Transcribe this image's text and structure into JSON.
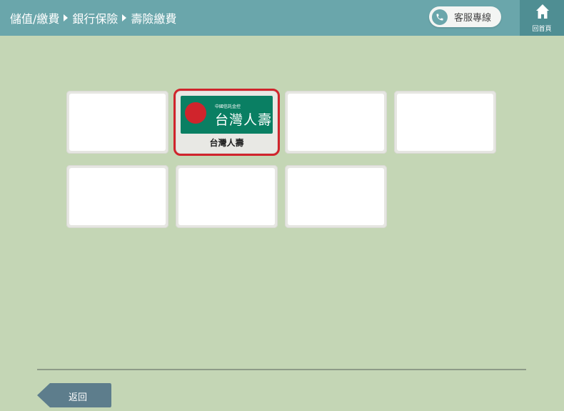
{
  "header": {
    "breadcrumbs": [
      "儲值/繳費",
      "銀行保險",
      "壽險繳費"
    ],
    "hotline_label": "客服專線",
    "home_label": "回首頁"
  },
  "tiles": [
    {
      "caption": ""
    },
    {
      "caption": "台灣人壽",
      "logo_small": "中國信託金控",
      "logo_big": "台灣人壽",
      "selected": true
    },
    {
      "caption": ""
    },
    {
      "caption": ""
    },
    {
      "caption": ""
    },
    {
      "caption": ""
    },
    {
      "caption": ""
    }
  ],
  "footer": {
    "back_label": "返回"
  },
  "colors": {
    "header_bg": "#6aa6ab",
    "home_bg": "#4f8e93",
    "page_bg": "#c4d6b5",
    "selected_outline": "#d0242c",
    "logo_green": "#0a7f63",
    "back_button": "#5d7d8c"
  }
}
